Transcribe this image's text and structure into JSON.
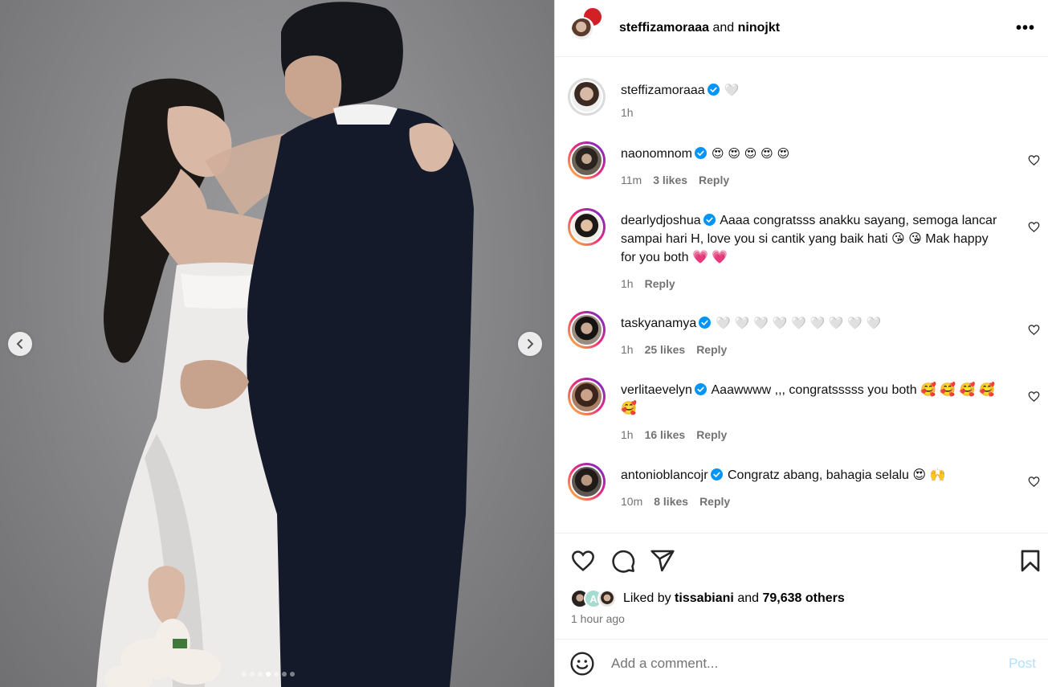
{
  "carousel": {
    "prev_icon": "chevron-left-icon",
    "next_icon": "chevron-right-icon",
    "total_slides": 7,
    "current_slide": 4
  },
  "header": {
    "user1": "steffizamoraaa",
    "connector": "and",
    "user2": "ninojkt",
    "more_icon": "more-horizontal-icon",
    "more_label": "•••"
  },
  "caption": {
    "username": "steffizamoraaa",
    "text": "🤍",
    "time": "1h"
  },
  "comments": [
    {
      "username": "naonomnom",
      "text": "😍 😍 😍 😍 😍",
      "time": "11m",
      "likes": "3 likes",
      "reply": "Reply"
    },
    {
      "username": "dearlydjoshua",
      "text": "Aaaa congratsss anakku sayang, semoga lancar sampai hari H, love you si cantik yang baik hati 😘 😘 Mak happy for you both 💗 💗",
      "time": "1h",
      "likes": "",
      "reply": "Reply"
    },
    {
      "username": "taskyanamya",
      "text": "🤍 🤍 🤍 🤍 🤍 🤍 🤍 🤍 🤍",
      "time": "1h",
      "likes": "25 likes",
      "reply": "Reply"
    },
    {
      "username": "verlitaevelyn",
      "text": "Aaawwww ,,, congratsssss you both 🥰 🥰 🥰 🥰 🥰",
      "time": "1h",
      "likes": "16 likes",
      "reply": "Reply"
    },
    {
      "username": "antonioblancojr",
      "text": "Congratz abang, bahagia selalu 😍 🙌",
      "time": "10m",
      "likes": "8 likes",
      "reply": "Reply"
    }
  ],
  "actions": {
    "like_icon": "heart-icon",
    "comment_icon": "comment-icon",
    "share_icon": "share-icon",
    "save_icon": "bookmark-icon"
  },
  "likes": {
    "prefix": "Liked by",
    "user": "tissabiani",
    "middle": "and",
    "others": "79,638 others",
    "avatar_letter": "A"
  },
  "time_ago": "1 hour ago",
  "composer": {
    "emoji_icon": "smiley-icon",
    "placeholder": "Add a comment...",
    "post_label": "Post"
  },
  "colors": {
    "verified": "#0095f6",
    "post_disabled": "#b2dffc",
    "muted": "#737373"
  }
}
